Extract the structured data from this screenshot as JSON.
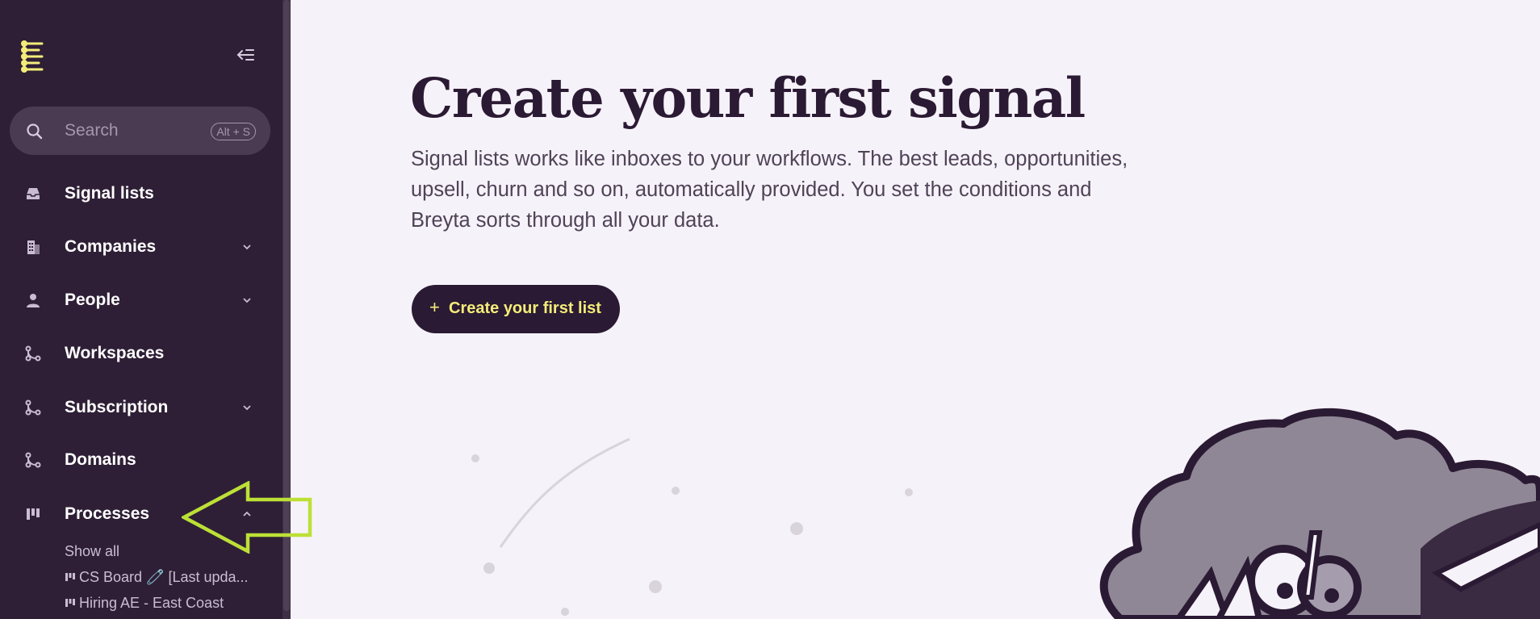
{
  "sidebar": {
    "search": {
      "placeholder": "Search",
      "shortcut": "Alt + S"
    },
    "items": [
      {
        "label": "Signal lists",
        "icon": "inbox-icon"
      },
      {
        "label": "Companies",
        "icon": "building-icon"
      },
      {
        "label": "People",
        "icon": "person-icon"
      },
      {
        "label": "Workspaces",
        "icon": "branch-icon"
      },
      {
        "label": "Subscription",
        "icon": "branch-icon"
      },
      {
        "label": "Domains",
        "icon": "branch-icon"
      },
      {
        "label": "Processes",
        "icon": "board-icon"
      }
    ],
    "processes": {
      "show_all": "Show all",
      "boards": [
        {
          "label": "CS Board 🧷 [Last upda..."
        },
        {
          "label": "Hiring AE - East Coast"
        }
      ]
    }
  },
  "main": {
    "title": "Create your first signal",
    "description": "Signal lists works like inboxes to your workflows. The best leads, opportunities, upsell, churn and so on, automatically provided. You set the conditions and Breyta sorts through all your data.",
    "create_button": {
      "icon": "+",
      "label": "Create your first list"
    }
  },
  "colors": {
    "sidebar_bg": "#2e1f36",
    "page_bg": "#f6f2f9",
    "button_bg": "#2b1a33",
    "button_text": "#f3ec7a",
    "annotation_arrow": "#bde036"
  }
}
